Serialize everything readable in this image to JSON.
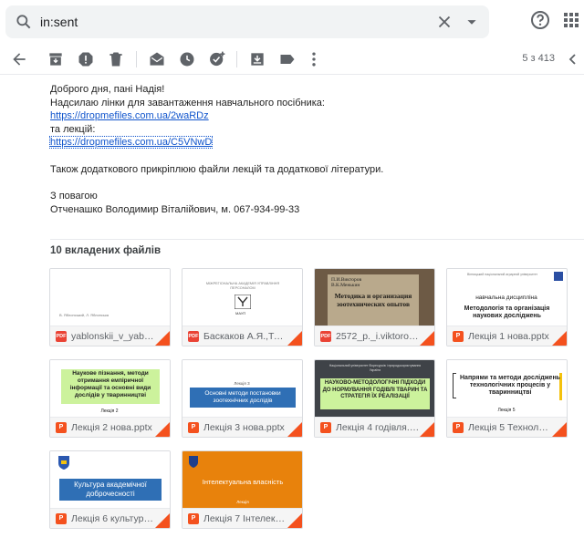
{
  "search": {
    "query": "in:sent"
  },
  "pager": {
    "text": "5 з 413"
  },
  "message": {
    "greeting": "Доброго дня, пані Надія!",
    "line1": "Надсилаю лінки для завантаження навчального посібника:",
    "link1": "https://dropmefiles.com.ua/2waRDz",
    "line2": "та лекцій:",
    "link2": "https://dropmefiles.com.ua/C5VNwD",
    "line3": "Також додаткового прикріплюю файли лекцій та додаткової літератури.",
    "sign1": "З повагою",
    "sign2": "Отченашко Володимир Віталійович, м. 067-934-99-33"
  },
  "attachments": {
    "title": "10 вкладених файлів",
    "files": [
      {
        "name": "yablonskii_v_yablo…",
        "type": "PDF"
      },
      {
        "name": "Баскаков А.Я.,Тул…",
        "type": "PDF"
      },
      {
        "name": "2572_p._i.viktorov_…",
        "type": "PDF"
      },
      {
        "name": "Лекція 1 нова.pptx",
        "type": "P"
      },
      {
        "name": "Лекція 2 нова.pptx",
        "type": "P"
      },
      {
        "name": "Лекція 3 нова.pptx",
        "type": "P"
      },
      {
        "name": "Лекція 4 годівля.p…",
        "type": "P"
      },
      {
        "name": "Лекція 5 Технологі…",
        "type": "P"
      },
      {
        "name": "Лекція 6 культура …",
        "type": "P"
      },
      {
        "name": "Лекція 7 Інтелект…",
        "type": "P"
      }
    ]
  },
  "thumbs": {
    "t1": "В. Яблонський, Л. Яблонська",
    "t2a": "МІЖРЕГІОНАЛЬНА АКАДЕМІЯ УПРАВЛІННЯ ПЕРСОНАЛОМ",
    "t2b": "МАУП",
    "t3a": "П.И.Викторов В.К.Менькин",
    "t3b": "Методика и организация зоотехнических опытов",
    "t4a": "Вінницький національний аграрний університет",
    "t4b": "навчальна дисципліна",
    "t4c": "Методологія та організація наукових досліджень",
    "t5a": "Наукове пізнання, методи отримання емпіричної інформації та основні види дослідів у тваринництві",
    "t5b": "Лекція 2",
    "t6a": "Основні методи постановки зоотехнічних дослідів",
    "t6b": "Лекція 3",
    "t7a": "Національний університет біоресурсів і природокористування України",
    "t7b": "НАУКОВО-МЕТОДОЛОГІЧНІ ПІДХОДИ ДО НОРМУВАННЯ ГОДІВЛІ ТВАРИН ТА СТРАТЕГІЯ ЇХ РЕАЛІЗАЦІЇ",
    "t8a": "Напрями та методи досліджень технологічних процесів у тваринництві",
    "t8b": "Лекція 5",
    "t9a": "Культура академічної доброчесності",
    "t10a": "Інтелектуальна власність",
    "t10b": "Лекція"
  },
  "colors": {
    "link": "#1155cc",
    "accent": "#f4511e",
    "pdf": "#ea4335"
  }
}
